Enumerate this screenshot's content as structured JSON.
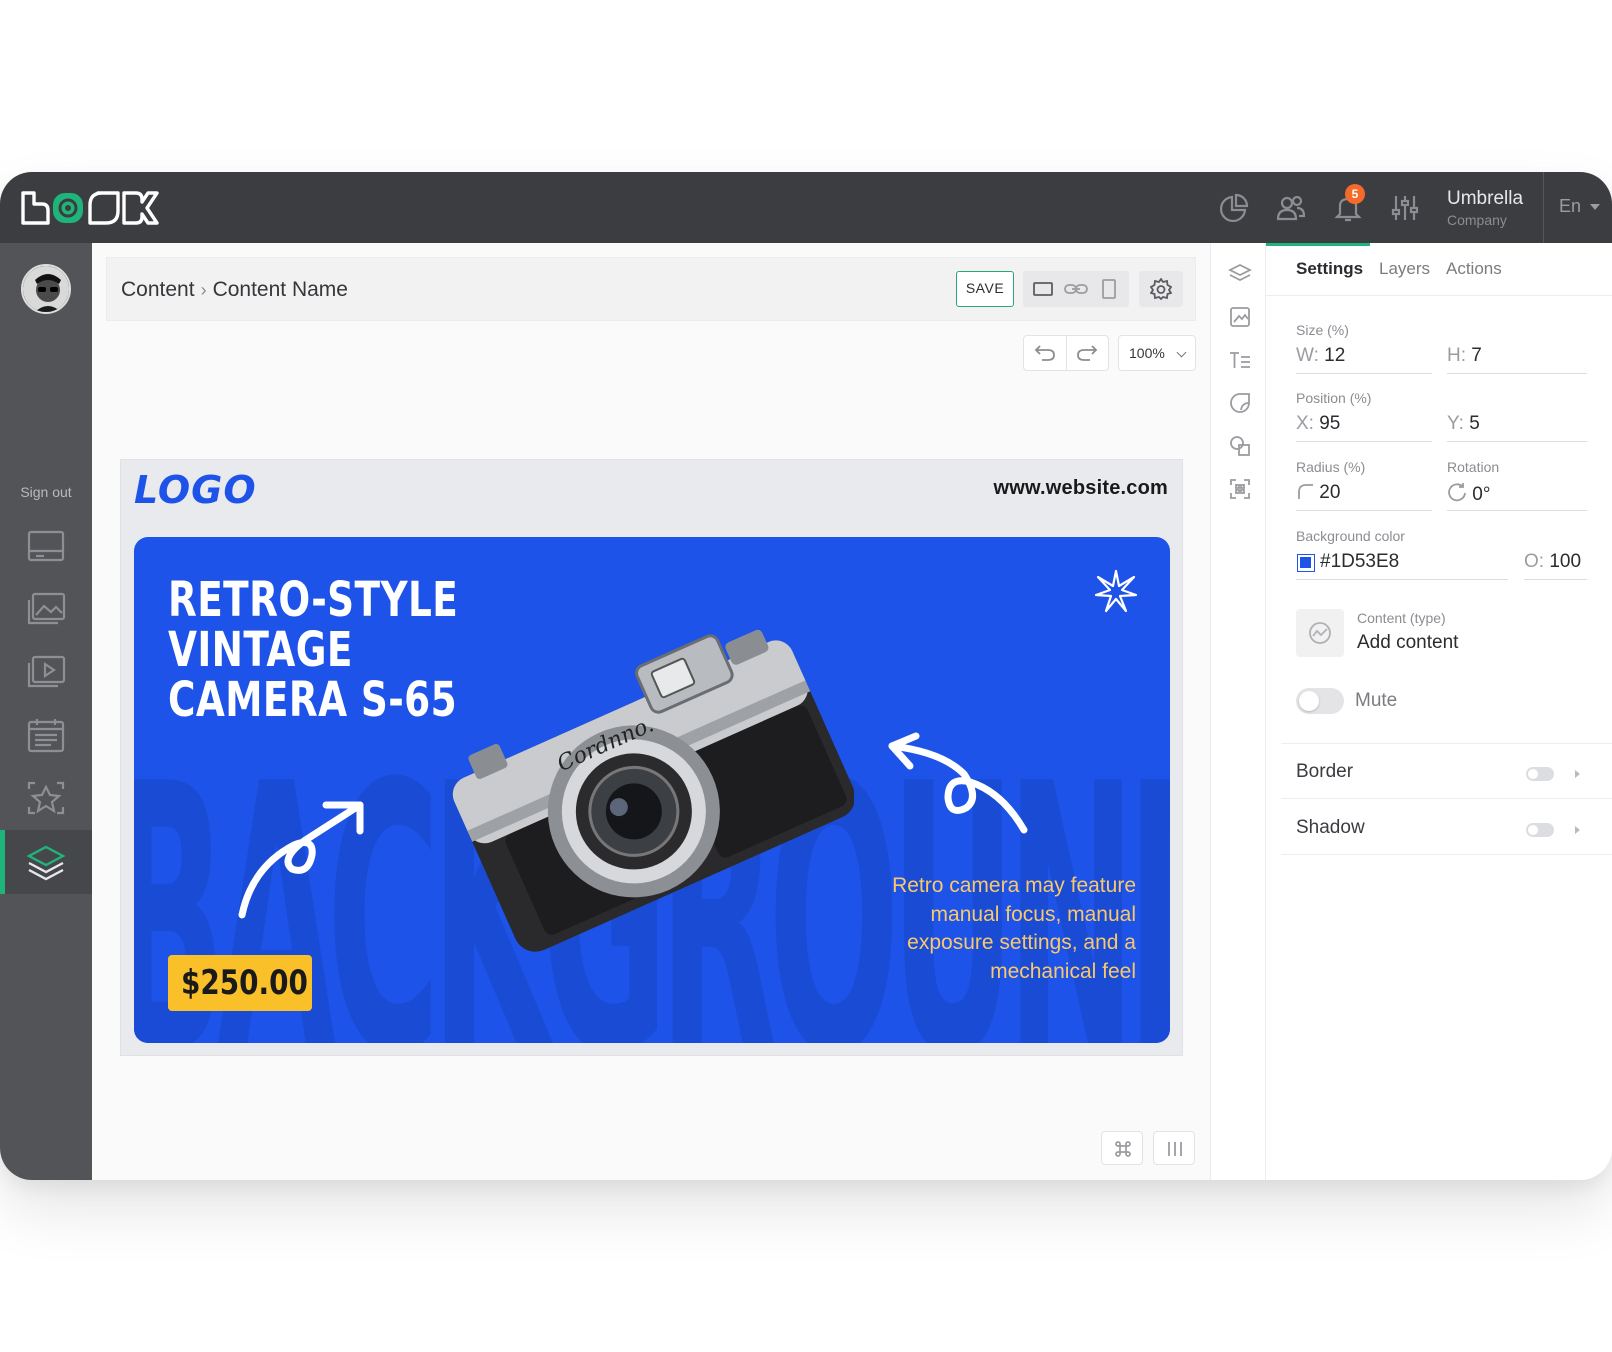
{
  "topbar": {
    "notification_count": "5",
    "user_name": "Umbrella",
    "user_company": "Company",
    "language": "En",
    "icons": [
      "analytics-icon",
      "users-icon",
      "bell-icon",
      "sliders-icon"
    ]
  },
  "sidebar": {
    "sign_out": "Sign out",
    "items": [
      "screens-icon",
      "images-icon",
      "video-icon",
      "schedule-icon",
      "favorites-icon",
      "layers-icon",
      "book-icon",
      "chat-icon"
    ],
    "active": "layers-icon"
  },
  "editor": {
    "breadcrumb_root": "Content",
    "breadcrumb_separator": "›",
    "breadcrumb_current": "Content Name",
    "save_label": "SAVE",
    "zoom": "100%"
  },
  "banner": {
    "logo_text": "LOGO",
    "website": "www.website.com",
    "background_word": "BACKGROUND",
    "headline_1": "RETRO-STYLE",
    "headline_2": "VINTAGE",
    "headline_3": "CAMERA S-65",
    "price": "$250.00",
    "camera_brand": "Cordnno.",
    "description": "Retro camera may feature manual focus, manual exposure settings, and a mechanical feel",
    "colors": {
      "banner": "#1D53E8",
      "price": "#F9C02A",
      "description": "#F9C86A"
    }
  },
  "panel": {
    "tabs": [
      "Settings",
      "Layers",
      "Actions"
    ],
    "active_tab": "Settings",
    "size_label": "Size (%)",
    "width_key": "W:",
    "width": "12",
    "height_key": "H:",
    "height": "7",
    "position_label": "Position (%)",
    "x_key": "X:",
    "x": "95",
    "y_key": "Y:",
    "y": "5",
    "radius_label": "Radius (%)",
    "radius": "20",
    "rotation_label": "Rotation",
    "rotation": "0°",
    "bg_color_label": "Background color",
    "bg_color": "#1D53E8",
    "opacity_key": "O:",
    "opacity": "100",
    "content_type_label": "Content (type)",
    "content_type_value": "Add content",
    "mute_label": "Mute",
    "border_label": "Border",
    "shadow_label": "Shadow"
  }
}
